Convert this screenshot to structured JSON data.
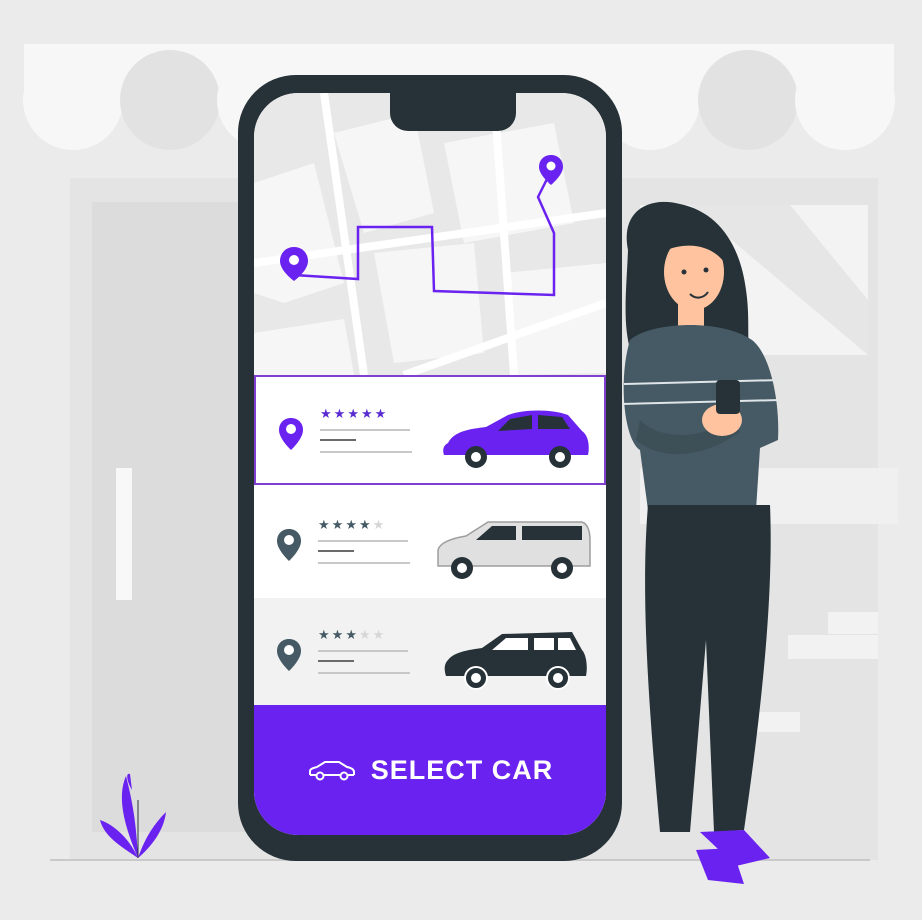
{
  "colors": {
    "accent": "#6a22f0",
    "accent_dark": "#5a2bd1",
    "phone_frame": "#263238",
    "background": "#ebebeb"
  },
  "map": {
    "icons": [
      "start-pin-icon",
      "destination-pin-icon",
      "route-line"
    ]
  },
  "car_options": [
    {
      "name": "suv",
      "rating": 5,
      "max_rating": 5,
      "selected": true,
      "color": "#6a22f0",
      "icon": "suv-car-icon"
    },
    {
      "name": "van",
      "rating": 4,
      "max_rating": 5,
      "selected": false,
      "color": "#e0e0e0",
      "icon": "van-car-icon"
    },
    {
      "name": "jeep",
      "rating": 3,
      "max_rating": 5,
      "selected": false,
      "color": "#263238",
      "icon": "jeep-car-icon"
    }
  ],
  "select_button": {
    "label": "SELECT CAR",
    "icon": "car-outline-icon"
  }
}
